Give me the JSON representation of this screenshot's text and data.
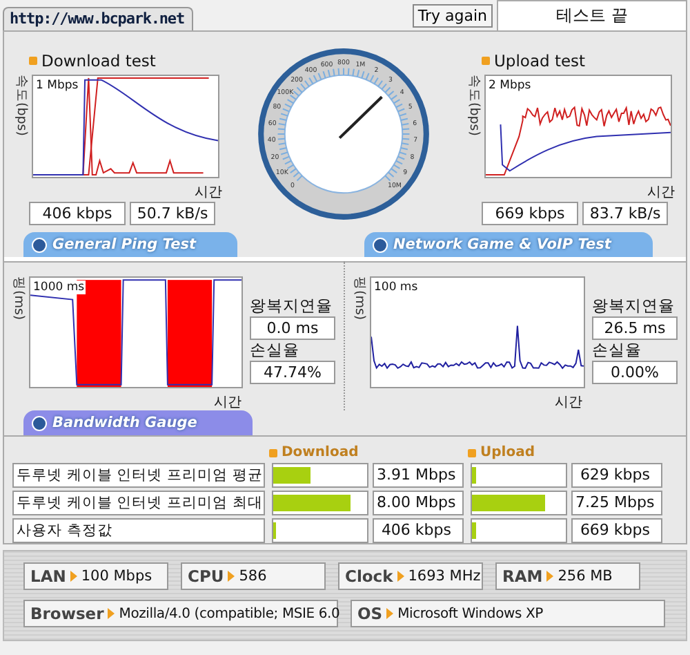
{
  "header": {
    "site_tab": "http://www.bcpark.net",
    "retry_button": "Try again",
    "status": "테스트 끝"
  },
  "download": {
    "title": "Download test",
    "ylabel": "속도(bps)",
    "scale": "1 Mbps",
    "xlabel": "시간",
    "rate": "406 kbps",
    "bytes": "50.7 kB/s"
  },
  "gauge": {
    "labels": [
      "0",
      "10K",
      "20",
      "40",
      "60",
      "80",
      "100K",
      "200",
      "400",
      "600",
      "800",
      "1M",
      "2",
      "3",
      "4",
      "5",
      "6",
      "7",
      "8",
      "9",
      "10M"
    ],
    "level": 0.67
  },
  "upload": {
    "title": "Upload test",
    "ylabel": "속도(bps)",
    "scale": "2 Mbps",
    "xlabel": "시간",
    "rate": "669 kbps",
    "bytes": "83.7 kB/s"
  },
  "ping_tests": [
    {
      "kind": "ping",
      "tab": "General Ping Test",
      "ylabel": "핑(ms)",
      "scale": "1000 ms",
      "xlabel": "시간",
      "latency_label": "왕복지연율",
      "latency": "0.0 ms",
      "loss_label": "손실율",
      "loss": "47.74%"
    },
    {
      "kind": "game",
      "tab": "Network Game & VoIP Test",
      "ylabel": "핑(ms)",
      "scale": "100 ms",
      "xlabel": "시간",
      "latency_label": "왕복지연율",
      "latency": "26.5 ms",
      "loss_label": "손실율",
      "loss": "0.00%"
    }
  ],
  "bandwidth": {
    "tab": "Bandwidth Gauge",
    "download_heading": "Download",
    "upload_heading": "Upload",
    "rows": [
      {
        "label": "두루넷 케이블 인터넷 프리미엄 평균",
        "download": {
          "level": 0.4,
          "value": "3.91 Mbps"
        },
        "upload": {
          "level": 0.04,
          "value": "629 kbps"
        }
      },
      {
        "label": "두루넷 케이블 인터넷 프리미엄 최대",
        "download": {
          "level": 0.82,
          "value": "8.00 Mbps"
        },
        "upload": {
          "level": 0.78,
          "value": "7.25 Mbps"
        }
      },
      {
        "label": "사용자 측정값",
        "download": {
          "level": 0.03,
          "value": "406 kbps"
        },
        "upload": {
          "level": 0.04,
          "value": "669 kbps"
        }
      }
    ]
  },
  "system": [
    {
      "label": "LAN",
      "value": "100 Mbps"
    },
    {
      "label": "CPU",
      "value": "586"
    },
    {
      "label": "Clock",
      "value": "1693 MHz"
    },
    {
      "label": "RAM",
      "value": "256 MB"
    },
    {
      "label": "Browser",
      "value": "Mozilla/4.0 (compatible; MSIE 6.0"
    },
    {
      "label": "OS",
      "value": "Microsoft Windows XP"
    }
  ]
}
